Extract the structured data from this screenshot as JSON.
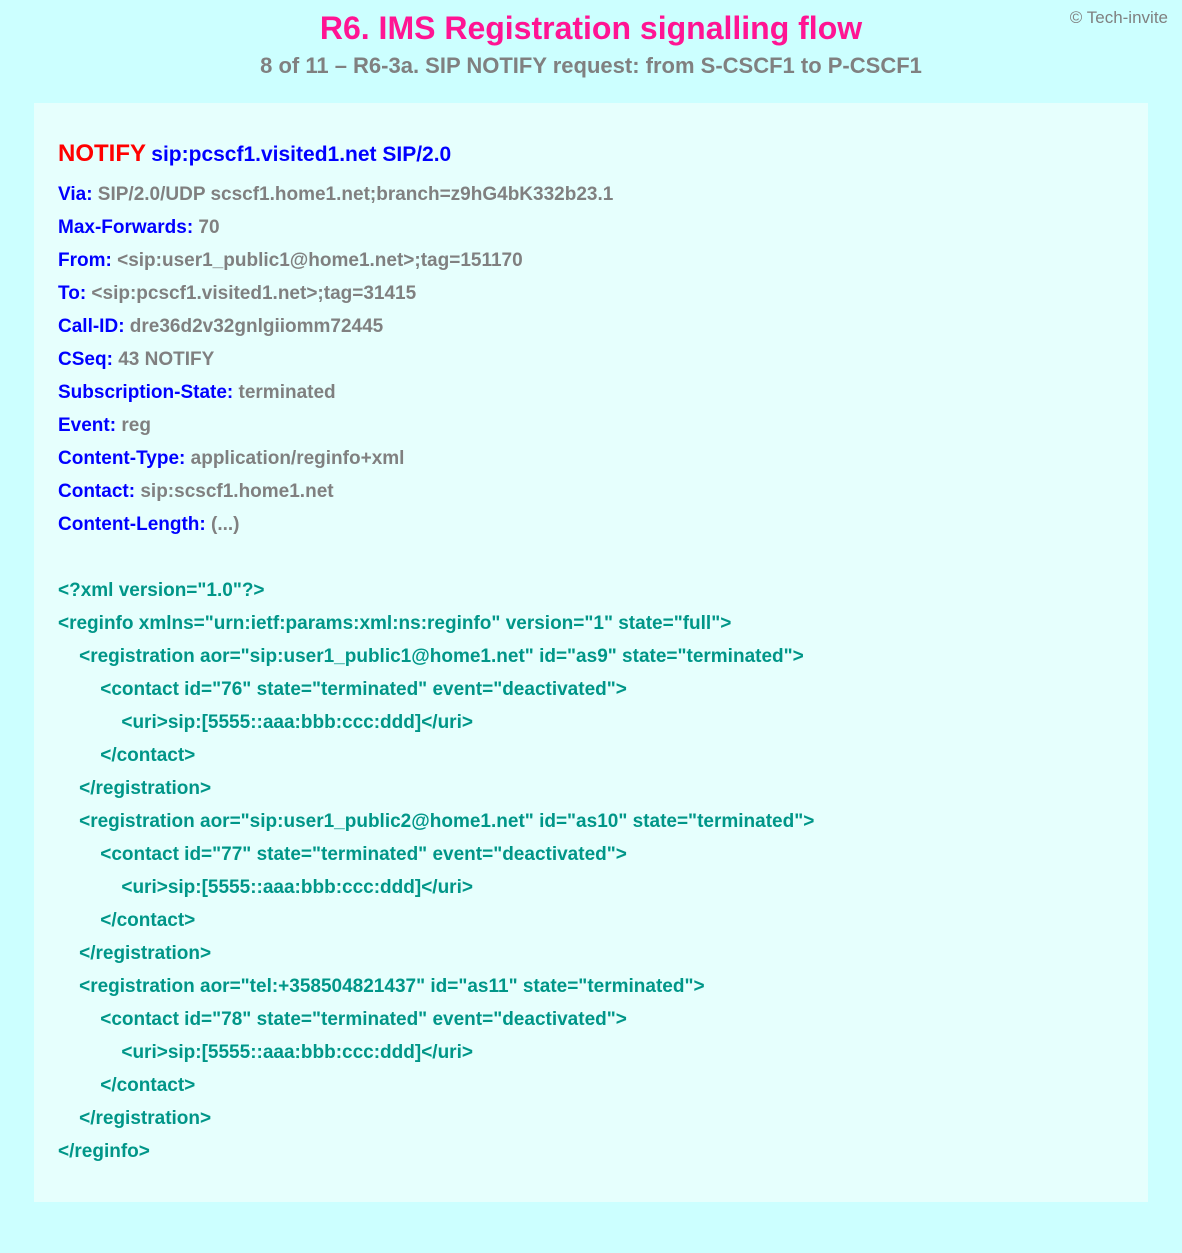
{
  "copyright": "© Tech-invite",
  "header": {
    "title": "R6. IMS Registration signalling flow",
    "subtitle": "8 of 11 – R6-3a. SIP NOTIFY request: from S-CSCF1 to P-CSCF1"
  },
  "request": {
    "method": "NOTIFY",
    "uri": "sip:pcscf1.visited1.net SIP/2.0"
  },
  "headers": [
    {
      "name": "Via",
      "value": "SIP/2.0/UDP scscf1.home1.net;branch=z9hG4bK332b23.1"
    },
    {
      "name": "Max-Forwards",
      "value": "70"
    },
    {
      "name": "From",
      "value": "<sip:user1_public1@home1.net>;tag=151170"
    },
    {
      "name": "To",
      "value": "<sip:pcscf1.visited1.net>;tag=31415"
    },
    {
      "name": "Call-ID",
      "value": "dre36d2v32gnlgiiomm72445"
    },
    {
      "name": "CSeq",
      "value": "43 NOTIFY"
    },
    {
      "name": "Subscription-State",
      "value": "terminated"
    },
    {
      "name": "Event",
      "value": "reg"
    },
    {
      "name": "Content-Type",
      "value": "application/reginfo+xml"
    },
    {
      "name": "Contact",
      "value": "sip:scscf1.home1.net"
    },
    {
      "name": "Content-Length",
      "value": "(...)"
    }
  ],
  "xml_body": "<?xml version=\"1.0\"?>\n<reginfo xmlns=\"urn:ietf:params:xml:ns:reginfo\" version=\"1\" state=\"full\">\n    <registration aor=\"sip:user1_public1@home1.net\" id=\"as9\" state=\"terminated\">\n        <contact id=\"76\" state=\"terminated\" event=\"deactivated\">\n            <uri>sip:[5555::aaa:bbb:ccc:ddd]</uri>\n        </contact>\n    </registration>\n    <registration aor=\"sip:user1_public2@home1.net\" id=\"as10\" state=\"terminated\">\n        <contact id=\"77\" state=\"terminated\" event=\"deactivated\">\n            <uri>sip:[5555::aaa:bbb:ccc:ddd]</uri>\n        </contact>\n    </registration>\n    <registration aor=\"tel:+358504821437\" id=\"as11\" state=\"terminated\">\n        <contact id=\"78\" state=\"terminated\" event=\"deactivated\">\n            <uri>sip:[5555::aaa:bbb:ccc:ddd]</uri>\n        </contact>\n    </registration>\n</reginfo>"
}
